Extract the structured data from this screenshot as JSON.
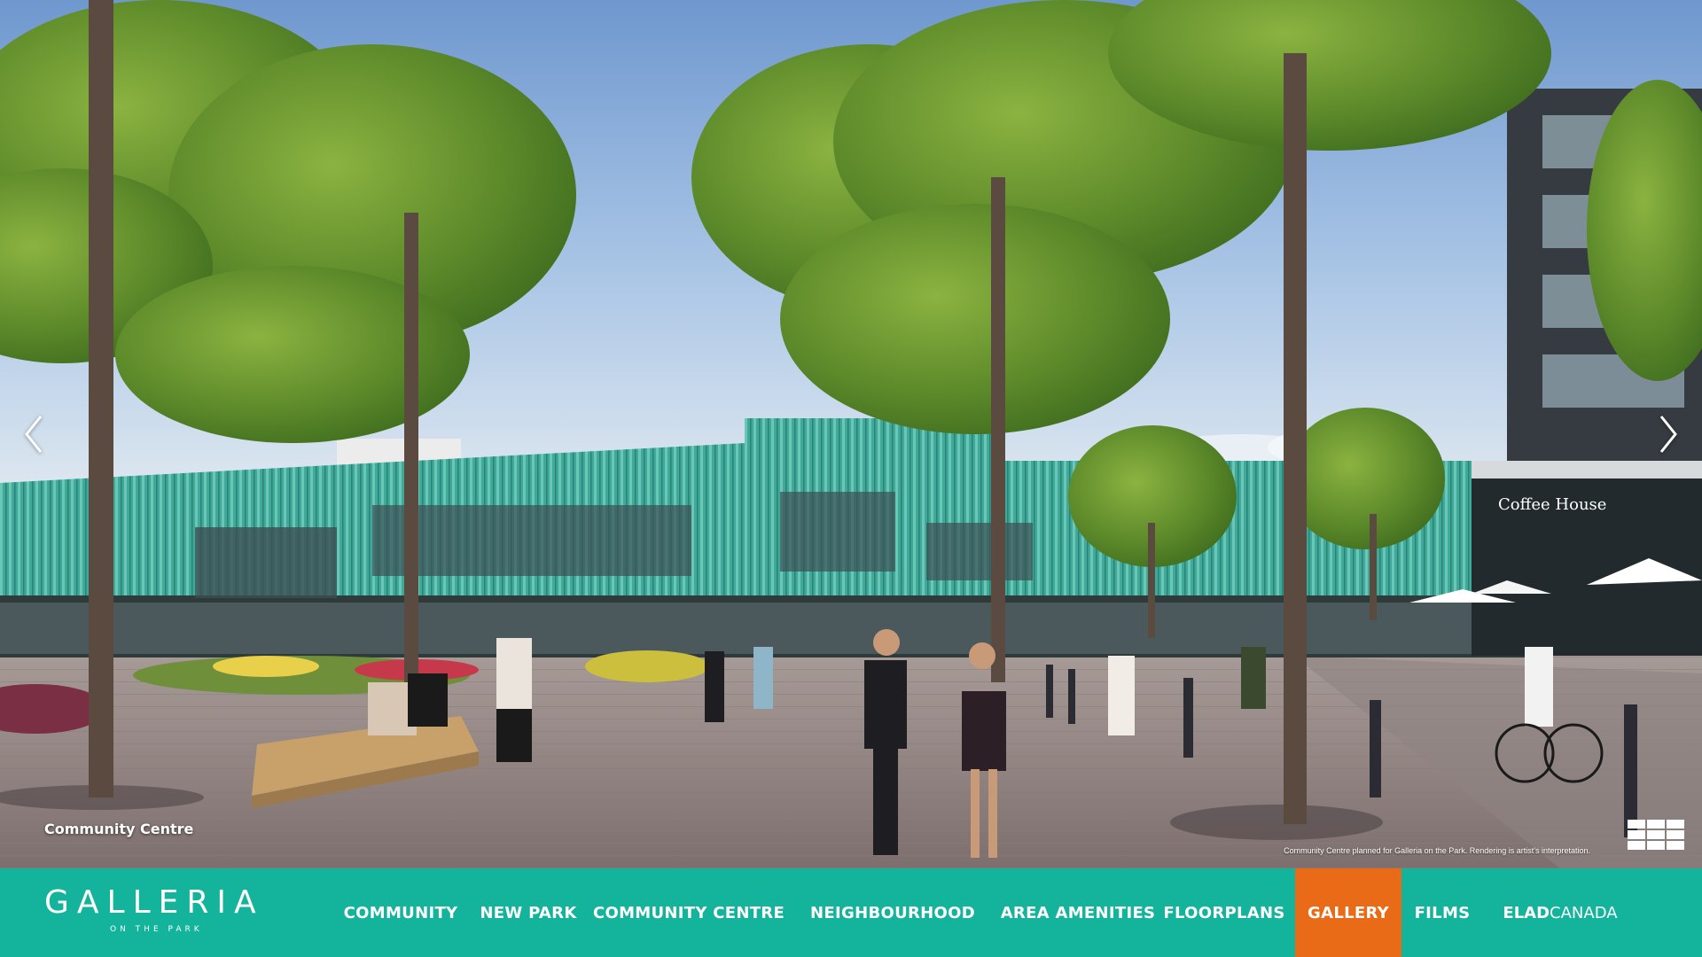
{
  "slide": {
    "caption": "Community Centre",
    "disclaimer": "Community Centre planned for Galleria on the Park. Rendering is artist's interpretation.",
    "shop_sign": "Coffee House"
  },
  "gallery_controls": {
    "prev_icon": "chevron-left-icon",
    "next_icon": "chevron-right-icon",
    "grid_icon": "grid-view-icon"
  },
  "logo": {
    "main": "GALLERIA",
    "sub": "ON THE PARK"
  },
  "nav": {
    "items": [
      {
        "label": "COMMUNITY",
        "active": false
      },
      {
        "label": "NEW PARK",
        "active": false
      },
      {
        "label": "COMMUNITY CENTRE",
        "active": false
      },
      {
        "label": "NEIGHBOURHOOD",
        "active": false
      },
      {
        "label": "AREA AMENITIES",
        "active": false
      },
      {
        "label": "FLOORPLANS",
        "active": false
      },
      {
        "label": "GALLERY",
        "active": true
      },
      {
        "label": "FILMS",
        "active": false
      }
    ],
    "brand_bold": "ELAD",
    "brand_light": "CANADA"
  },
  "colors": {
    "nav_background": "#14b39b",
    "active_tab": "#e96a17",
    "building_teal": "#3fa99a",
    "text": "#ffffff"
  }
}
